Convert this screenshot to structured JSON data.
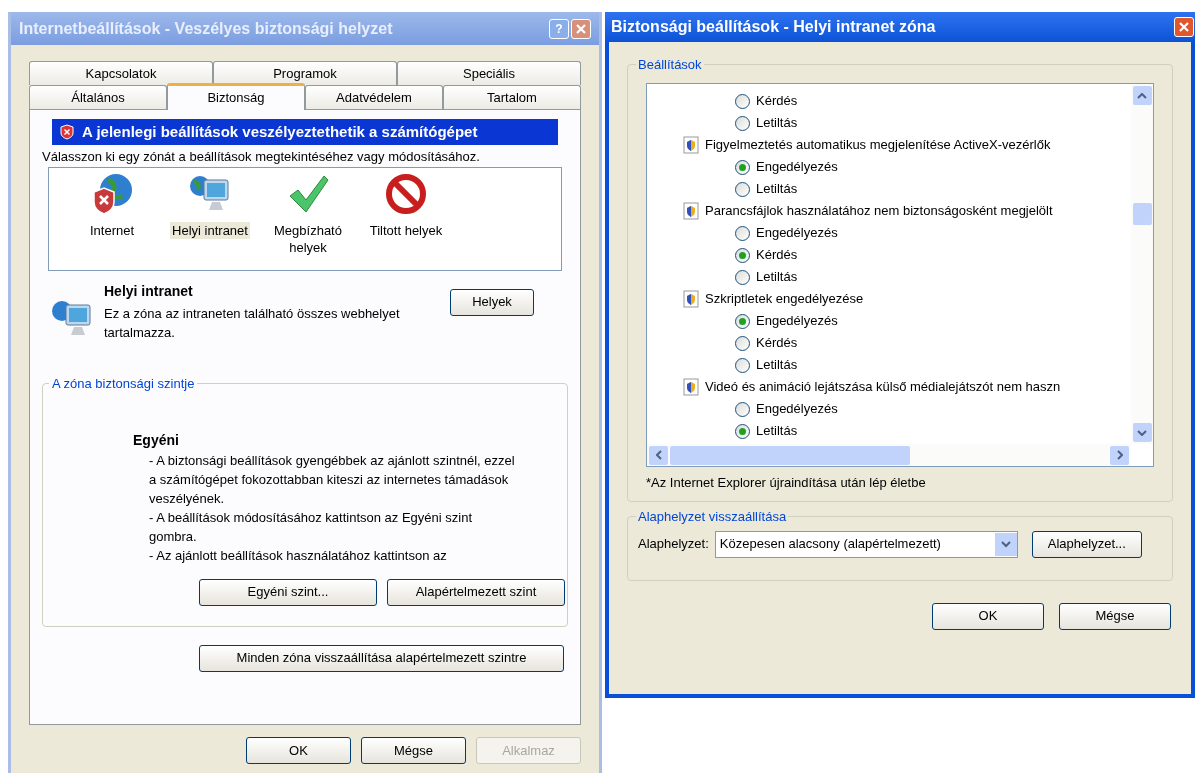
{
  "left_window": {
    "title": "Internetbeállítások - Veszélyes biztonsági helyzet",
    "help": "?",
    "tab_rows": [
      [
        {
          "label": "Kapcsolatok",
          "selected": false
        },
        {
          "label": "Programok",
          "selected": false
        },
        {
          "label": "Speciális",
          "selected": false
        }
      ],
      [
        {
          "label": "Általános",
          "selected": false
        },
        {
          "label": "Biztonság",
          "selected": true
        },
        {
          "label": "Adatvédelem",
          "selected": false
        },
        {
          "label": "Tartalom",
          "selected": false
        }
      ]
    ],
    "warning_banner": "A jelenlegi beállítások veszélyeztethetik a számítógépet",
    "zone_prompt": "Válasszon ki egy zónát a beállítások megtekintéséhez vagy módosításához.",
    "zones": [
      {
        "kind": "internet",
        "label": "Internet",
        "selected": false
      },
      {
        "kind": "intranet",
        "label": "Helyi intranet",
        "selected": true
      },
      {
        "kind": "trusted",
        "label": "Megbízható helyek",
        "selected": false
      },
      {
        "kind": "restricted",
        "label": "Tiltott helyek",
        "selected": false
      }
    ],
    "zone_title": "Helyi intranet",
    "zone_description": "Ez a zóna az intraneten található összes webhelyet tartalmazza.",
    "sites_button": "Helyek",
    "level_group": {
      "legend": "A zóna biztonsági szintje",
      "level_name": "Egyéni",
      "lines": [
        "- A biztonsági beállítások gyengébbek az ajánlott szintnél, ezzel a számítógépet fokozottabban kiteszi az internetes támadások veszélyének.",
        "- A beállítások módosításához kattintson az Egyéni szint gombra.",
        "- Az ajánlott beállítások használatához kattintson az"
      ],
      "buttons": [
        "Egyéni szint...",
        "Alapértelmezett szint"
      ]
    },
    "reset_all_button": "Minden zóna visszaállítása alapértelmezett szintre",
    "footer_buttons": [
      {
        "label": "OK",
        "disabled": false
      },
      {
        "label": "Mégse",
        "disabled": false
      },
      {
        "label": "Alkalmaz",
        "disabled": true
      }
    ]
  },
  "right_window": {
    "title": "Biztonsági beállítások - Helyi intranet zóna",
    "settings_legend": "Beállítások",
    "settings": [
      {
        "kind": "option",
        "label": "Kérdés",
        "selected": false
      },
      {
        "kind": "option",
        "label": "Letiltás",
        "selected": false
      },
      {
        "kind": "header",
        "label": "Figyelmeztetés automatikus megjelenítése ActiveX-vezérlők"
      },
      {
        "kind": "option",
        "label": "Engedélyezés",
        "selected": true
      },
      {
        "kind": "option",
        "label": "Letiltás",
        "selected": false
      },
      {
        "kind": "header",
        "label": "Parancsfájlok használatához nem biztonságosként megjelölt"
      },
      {
        "kind": "option",
        "label": "Engedélyezés",
        "selected": false
      },
      {
        "kind": "option",
        "label": "Kérdés",
        "selected": true
      },
      {
        "kind": "option",
        "label": "Letiltás",
        "selected": false
      },
      {
        "kind": "header",
        "label": "Szkriptletek engedélyezése"
      },
      {
        "kind": "option",
        "label": "Engedélyezés",
        "selected": true
      },
      {
        "kind": "option",
        "label": "Kérdés",
        "selected": false
      },
      {
        "kind": "option",
        "label": "Letiltás",
        "selected": false
      },
      {
        "kind": "header",
        "label": "Videó és animáció lejátszása külső médialejátszót nem haszn"
      },
      {
        "kind": "option",
        "label": "Engedélyezés",
        "selected": false
      },
      {
        "kind": "option",
        "label": "Letiltás",
        "selected": true
      }
    ],
    "restart_note": "*Az Internet Explorer újraindítása után lép életbe",
    "reset_legend": "Alaphelyzet visszaállítása",
    "reset_label": "Alaphelyzet:",
    "reset_value": "Közepesen alacsony (alapértelmezett)",
    "reset_button": "Alaphelyzet...",
    "footer_buttons": [
      "OK",
      "Mégse"
    ]
  }
}
